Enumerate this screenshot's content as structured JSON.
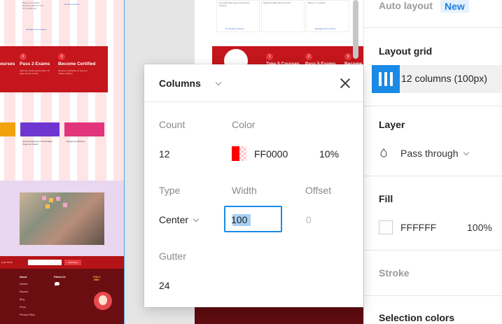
{
  "left_frame": {
    "cards_top": [
      {
        "lines": [
          "Being L.O Leaders",
          "Essential Skills for Any",
          "UX Practitioner"
        ],
        "link": ""
      },
      {
        "lines": [
          "",
          ""
        ],
        "link": "Design Lessons"
      },
      {
        "lines": [],
        "link": "Management Lessons"
      }
    ],
    "steps": [
      {
        "number": "",
        "title": "ourses",
        "sub": ""
      },
      {
        "number": "2",
        "title": "Pass 2 Exams",
        "sub": "Take the online exams within 10 days of each course"
      },
      {
        "number": "3",
        "title": "Become Certified",
        "sub": "Receive certification to become master certified"
      }
    ],
    "cards_mid": [
      {
        "title": ""
      },
      {
        "title": "Journey Mapping to Understand Customer Needs"
      },
      {
        "title": "Designing Influence"
      }
    ],
    "footer": {
      "cta": "your inbox",
      "button": "Subscribe",
      "col1_heading": "About",
      "col1_items": [
        "Articles",
        "Reports",
        "Blog",
        "Press",
        "Privacy Policy"
      ],
      "col2_heading": "Follow Us",
      "badge": "YOU ♥ NNG"
    }
  },
  "mid_frame": {
    "cards": [
      {
        "title": "Storytelling Big Ideas with Design Thinking"
      },
      {
        "title": "Measuring Big Ideas and ROI"
      },
      {
        "title": "Being L.O Leaders"
      }
    ],
    "links": [
      "UX Design Lessons",
      "Management Lessons"
    ],
    "steps": [
      {
        "number": "1",
        "title": "Take 5 Courses"
      },
      {
        "number": "2",
        "title": "Pass 5 Exams"
      },
      {
        "number": "3",
        "title": "Become"
      }
    ]
  },
  "panel": {
    "auto_layout": {
      "title": "Auto layout",
      "badge": "New"
    },
    "layout_grid": {
      "title": "Layout grid",
      "summary": "12 columns (100px)"
    },
    "layer": {
      "title": "Layer",
      "blend": "Pass through"
    },
    "fill": {
      "title": "Fill",
      "hex": "FFFFFF",
      "opacity": "100%"
    },
    "stroke": {
      "title": "Stroke"
    },
    "selection_colors": {
      "title": "Selection colors"
    }
  },
  "popup": {
    "type_label": "Columns",
    "count": {
      "label": "Count",
      "value": "12"
    },
    "color": {
      "label": "Color",
      "hex": "FF0000",
      "opacity": "10%",
      "swatch": "#FF0000"
    },
    "type": {
      "label": "Type",
      "value": "Center"
    },
    "width": {
      "label": "Width",
      "value": "100"
    },
    "offset": {
      "label": "Offset",
      "value": "0"
    },
    "gutter": {
      "label": "Gutter",
      "value": "24"
    }
  },
  "colors": {
    "accent": "#1B8AE6",
    "brand_red": "#C4161C",
    "grid_tint": "#FF0000"
  }
}
